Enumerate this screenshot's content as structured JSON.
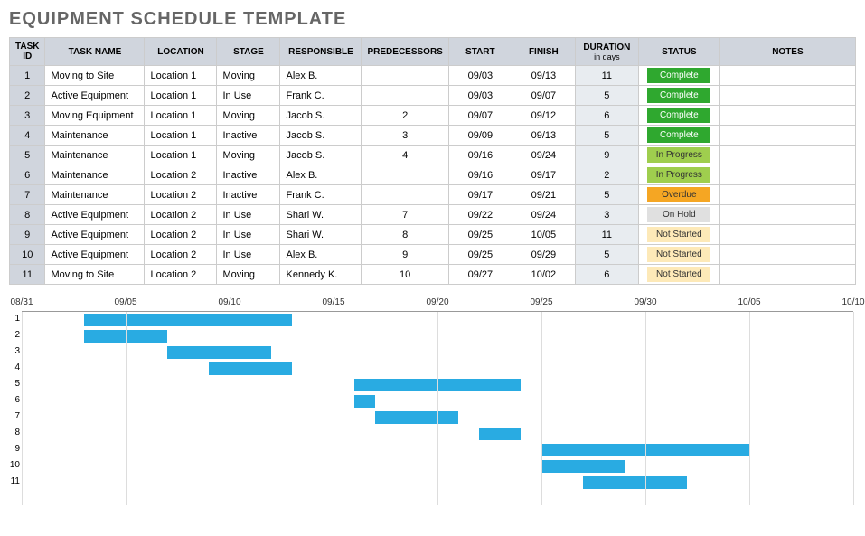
{
  "title": "EQUIPMENT SCHEDULE TEMPLATE",
  "columns": {
    "id": "TASK ID",
    "name": "TASK NAME",
    "location": "LOCATION",
    "stage": "STAGE",
    "responsible": "RESPONSIBLE",
    "predecessors": "PREDECESSORS",
    "start": "START",
    "finish": "FINISH",
    "duration": "DURATION",
    "duration_sub": "in days",
    "status": "STATUS",
    "notes": "NOTES"
  },
  "status_styles": {
    "Complete": "s-complete",
    "In Progress": "s-inprogress",
    "Overdue": "s-overdue",
    "On Hold": "s-onhold",
    "Not Started": "s-notstarted"
  },
  "rows": [
    {
      "id": "1",
      "name": "Moving to Site",
      "location": "Location 1",
      "stage": "Moving",
      "responsible": "Alex B.",
      "predecessors": "",
      "start": "09/03",
      "finish": "09/13",
      "duration": "11",
      "status": "Complete",
      "notes": ""
    },
    {
      "id": "2",
      "name": "Active Equipment",
      "location": "Location 1",
      "stage": "In Use",
      "responsible": "Frank C.",
      "predecessors": "",
      "start": "09/03",
      "finish": "09/07",
      "duration": "5",
      "status": "Complete",
      "notes": ""
    },
    {
      "id": "3",
      "name": "Moving Equipment",
      "location": "Location 1",
      "stage": "Moving",
      "responsible": "Jacob S.",
      "predecessors": "2",
      "start": "09/07",
      "finish": "09/12",
      "duration": "6",
      "status": "Complete",
      "notes": ""
    },
    {
      "id": "4",
      "name": "Maintenance",
      "location": "Location 1",
      "stage": "Inactive",
      "responsible": "Jacob S.",
      "predecessors": "3",
      "start": "09/09",
      "finish": "09/13",
      "duration": "5",
      "status": "Complete",
      "notes": ""
    },
    {
      "id": "5",
      "name": "Maintenance",
      "location": "Location 1",
      "stage": "Moving",
      "responsible": "Jacob S.",
      "predecessors": "4",
      "start": "09/16",
      "finish": "09/24",
      "duration": "9",
      "status": "In Progress",
      "notes": ""
    },
    {
      "id": "6",
      "name": "Maintenance",
      "location": "Location 2",
      "stage": "Inactive",
      "responsible": "Alex B.",
      "predecessors": "",
      "start": "09/16",
      "finish": "09/17",
      "duration": "2",
      "status": "In Progress",
      "notes": ""
    },
    {
      "id": "7",
      "name": "Maintenance",
      "location": "Location 2",
      "stage": "Inactive",
      "responsible": "Frank C.",
      "predecessors": "",
      "start": "09/17",
      "finish": "09/21",
      "duration": "5",
      "status": "Overdue",
      "notes": ""
    },
    {
      "id": "8",
      "name": "Active Equipment",
      "location": "Location 2",
      "stage": "In Use",
      "responsible": "Shari W.",
      "predecessors": "7",
      "start": "09/22",
      "finish": "09/24",
      "duration": "3",
      "status": "On Hold",
      "notes": ""
    },
    {
      "id": "9",
      "name": "Active Equipment",
      "location": "Location 2",
      "stage": "In Use",
      "responsible": "Shari W.",
      "predecessors": "8",
      "start": "09/25",
      "finish": "10/05",
      "duration": "11",
      "status": "Not Started",
      "notes": ""
    },
    {
      "id": "10",
      "name": "Active Equipment",
      "location": "Location 2",
      "stage": "In Use",
      "responsible": "Alex B.",
      "predecessors": "9",
      "start": "09/25",
      "finish": "09/29",
      "duration": "5",
      "status": "Not Started",
      "notes": ""
    },
    {
      "id": "11",
      "name": "Moving to Site",
      "location": "Location 2",
      "stage": "Moving",
      "responsible": "Kennedy K.",
      "predecessors": "10",
      "start": "09/27",
      "finish": "10/02",
      "duration": "6",
      "status": "Not Started",
      "notes": ""
    }
  ],
  "chart_data": {
    "type": "bar",
    "title": "",
    "xlabel": "",
    "ylabel": "",
    "x_ticks": [
      "08/31",
      "09/05",
      "09/10",
      "09/15",
      "09/20",
      "09/25",
      "09/30",
      "10/05",
      "10/10"
    ],
    "x_range_days": [
      0,
      40
    ],
    "series": [
      {
        "name": "1",
        "start_day": 3,
        "end_day": 13
      },
      {
        "name": "2",
        "start_day": 3,
        "end_day": 7
      },
      {
        "name": "3",
        "start_day": 7,
        "end_day": 12
      },
      {
        "name": "4",
        "start_day": 9,
        "end_day": 13
      },
      {
        "name": "5",
        "start_day": 16,
        "end_day": 24
      },
      {
        "name": "6",
        "start_day": 16,
        "end_day": 17
      },
      {
        "name": "7",
        "start_day": 17,
        "end_day": 21
      },
      {
        "name": "8",
        "start_day": 22,
        "end_day": 24
      },
      {
        "name": "9",
        "start_day": 25,
        "end_day": 35
      },
      {
        "name": "10",
        "start_day": 25,
        "end_day": 29
      },
      {
        "name": "11",
        "start_day": 27,
        "end_day": 32
      }
    ]
  }
}
